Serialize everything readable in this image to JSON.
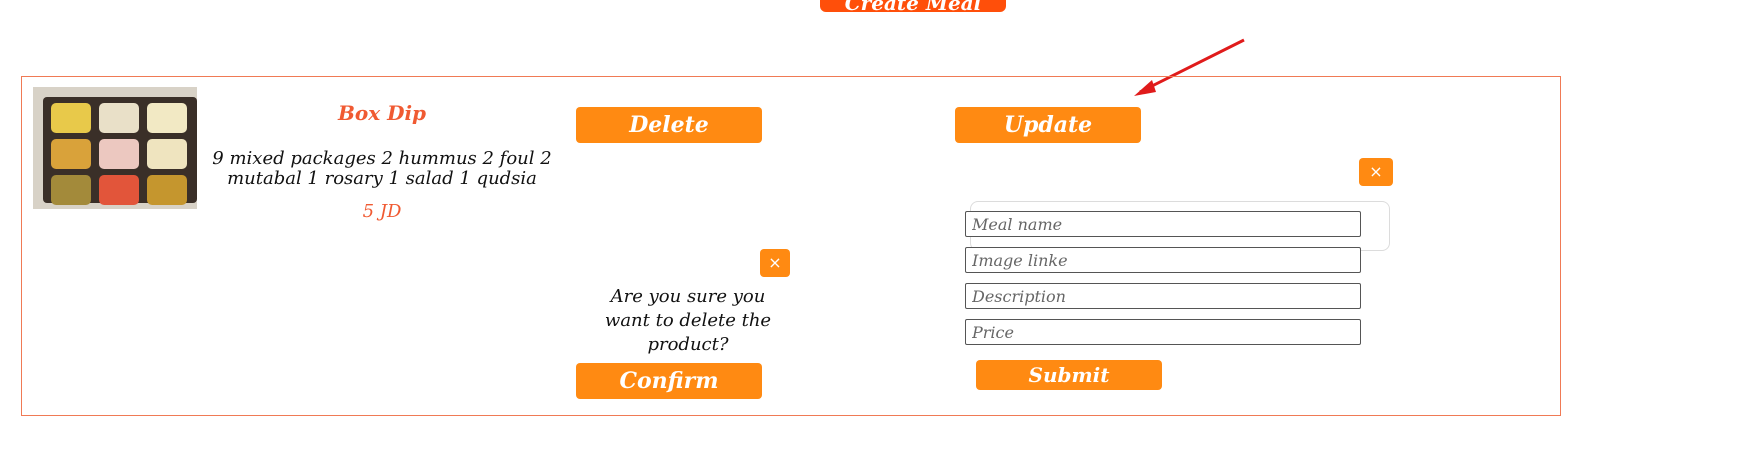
{
  "top_button": {
    "label": "Create Meal"
  },
  "meal": {
    "title": "Box Dip",
    "description": "9 mixed packages 2 hummus 2 foul 2 mutabal 1 rosary 1 salad 1 qudsia",
    "price": "5 JD"
  },
  "actions": {
    "delete_label": "Delete",
    "update_label": "Update",
    "close_symbol": "×"
  },
  "delete_dialog": {
    "question": "Are you sure you want to delete the product?",
    "confirm_label": "Confirm"
  },
  "update_form": {
    "meal_name_placeholder": "Meal name",
    "image_link_placeholder": "Image linke",
    "description_placeholder": "Description",
    "price_placeholder": "Price",
    "submit_label": "Submit"
  },
  "colors": {
    "accent_orange": "#ff8a12",
    "title_orange": "#f05a32",
    "card_border": "#f07a55",
    "top_button": "#ff4f0a",
    "annotation_arrow": "#e01b1b"
  },
  "icons": {
    "annotation": "red-arrow-icon",
    "close": "close-icon"
  }
}
